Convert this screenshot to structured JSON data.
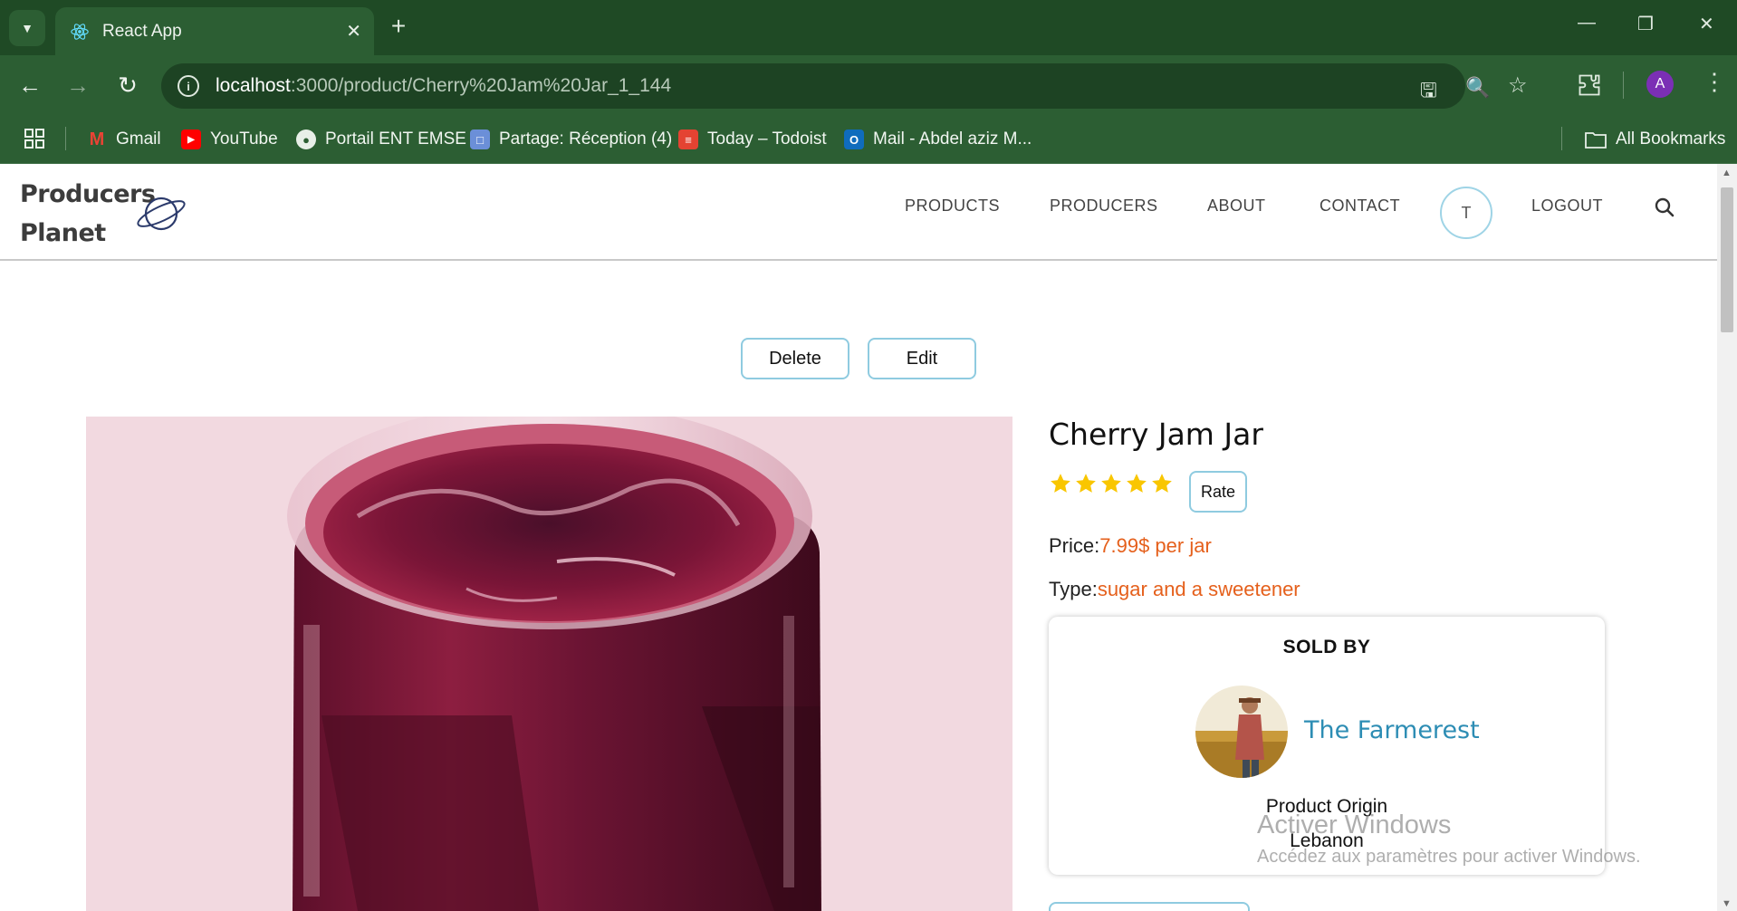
{
  "browser": {
    "tab_title": "React App",
    "url_host": "localhost",
    "url_path": ":3000/product/Cherry%20Jam%20Jar_1_144",
    "profile_initial": "A",
    "bookmarks": [
      {
        "label": "Gmail",
        "icon": "gmail-icon",
        "color": "#ea4335"
      },
      {
        "label": "YouTube",
        "icon": "youtube-icon",
        "color": "#ff0000"
      },
      {
        "label": "Portail ENT EMSE",
        "icon": "globe-icon",
        "color": "#e8efe8"
      },
      {
        "label": "Partage: Réception (4)",
        "icon": "partage-icon",
        "color": "#6b8fd8"
      },
      {
        "label": "Today – Todoist",
        "icon": "todoist-icon",
        "color": "#e44332"
      },
      {
        "label": "Mail - Abdel aziz M...",
        "icon": "outlook-icon",
        "color": "#0f6cbd"
      }
    ],
    "all_bookmarks": "All Bookmarks"
  },
  "site": {
    "logo_line1": "Producers",
    "logo_line2": "Planet",
    "nav": {
      "products": "PRODUCTS",
      "producers": "PRODUCERS",
      "about": "ABOUT",
      "contact": "CONTACT",
      "user_initial": "T",
      "logout": "LOGOUT"
    }
  },
  "actions": {
    "delete": "Delete",
    "edit": "Edit"
  },
  "product": {
    "name": "Cherry Jam Jar",
    "rating": 5,
    "rate_label": "Rate",
    "price_label": "Price:",
    "price_value": "7.99$ per jar",
    "type_label": "Type:",
    "type_value": "sugar and a sweetener"
  },
  "seller": {
    "heading": "SOLD BY",
    "name": "The Farmerest",
    "origin_label": "Product Origin",
    "origin_value": "Lebanon"
  },
  "watermark": {
    "line1": "Activer Windows",
    "line2": "Accédez aux paramètres pour activer Windows."
  },
  "colors": {
    "accent_orange": "#e5601c",
    "seller_blue": "#2d8db4",
    "button_border": "#8fcbe0",
    "star_gold": "#f9c600"
  }
}
